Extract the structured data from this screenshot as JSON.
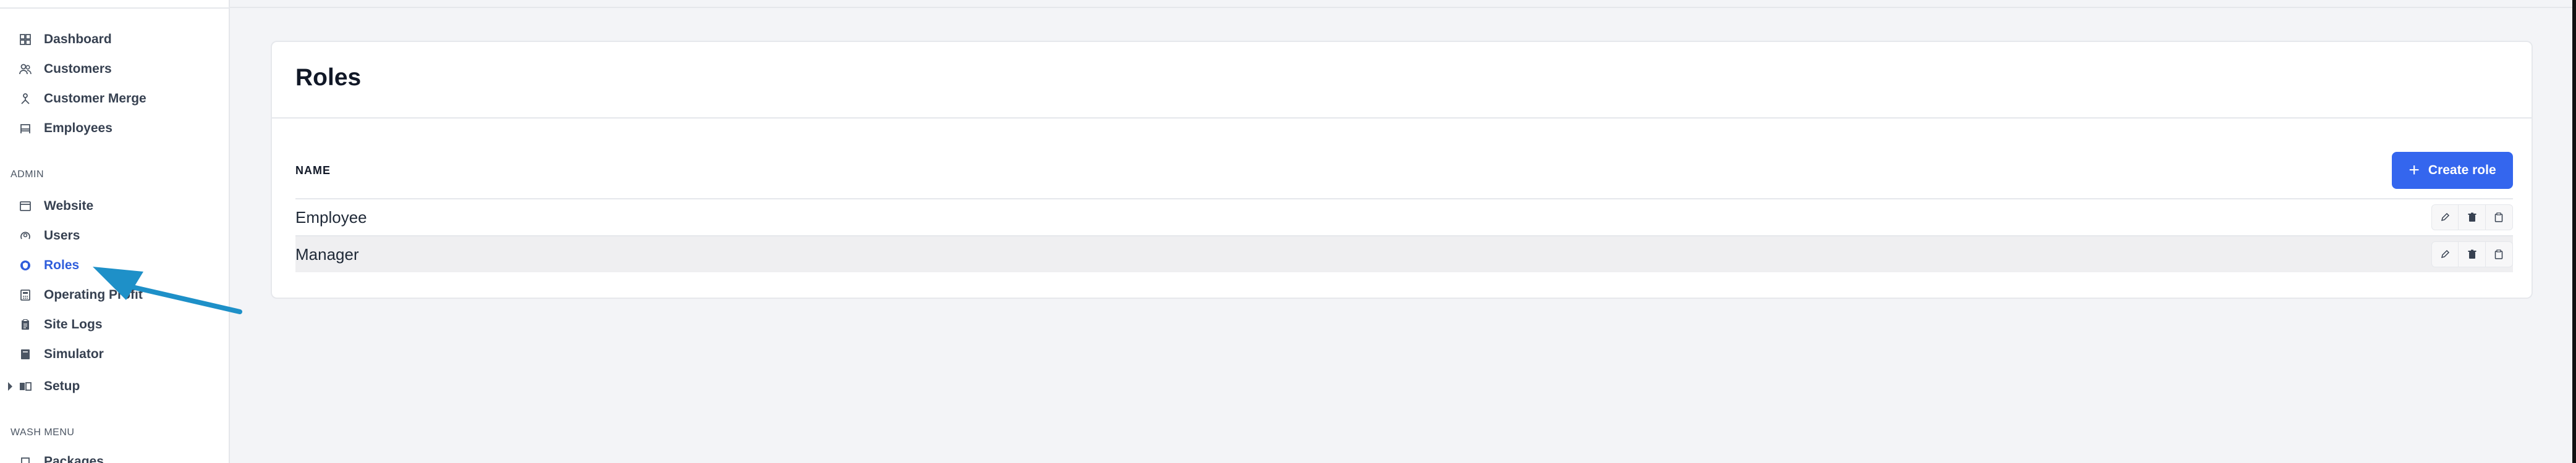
{
  "sidebar": {
    "items_top": [
      {
        "label": "Dashboard",
        "icon": "dashboard-icon"
      },
      {
        "label": "Customers",
        "icon": "users-icon"
      },
      {
        "label": "Customer Merge",
        "icon": "merge-icon"
      },
      {
        "label": "Employees",
        "icon": "employees-icon"
      }
    ],
    "admin_label": "ADMIN",
    "items_admin": [
      {
        "label": "Website",
        "icon": "browser-icon"
      },
      {
        "label": "Users",
        "icon": "user-icon"
      },
      {
        "label": "Roles",
        "icon": "shield-icon",
        "active": true
      },
      {
        "label": "Operating Profit",
        "icon": "calculator-icon"
      },
      {
        "label": "Site Logs",
        "icon": "clipboard-icon"
      },
      {
        "label": "Simulator",
        "icon": "simulator-icon"
      },
      {
        "label": "Setup",
        "icon": "setup-icon"
      }
    ],
    "wash_menu_label": "WASH MENU",
    "items_wash": [
      {
        "label": "Packages",
        "icon": "package-icon"
      }
    ]
  },
  "main": {
    "title": "Roles",
    "column_header": "NAME",
    "create_button": "Create role",
    "rows": [
      {
        "name": "Employee"
      },
      {
        "name": "Manager"
      }
    ]
  },
  "colors": {
    "accent": "#3466ee",
    "active_nav": "#2f5ddb",
    "arrow": "#1e90c8"
  }
}
